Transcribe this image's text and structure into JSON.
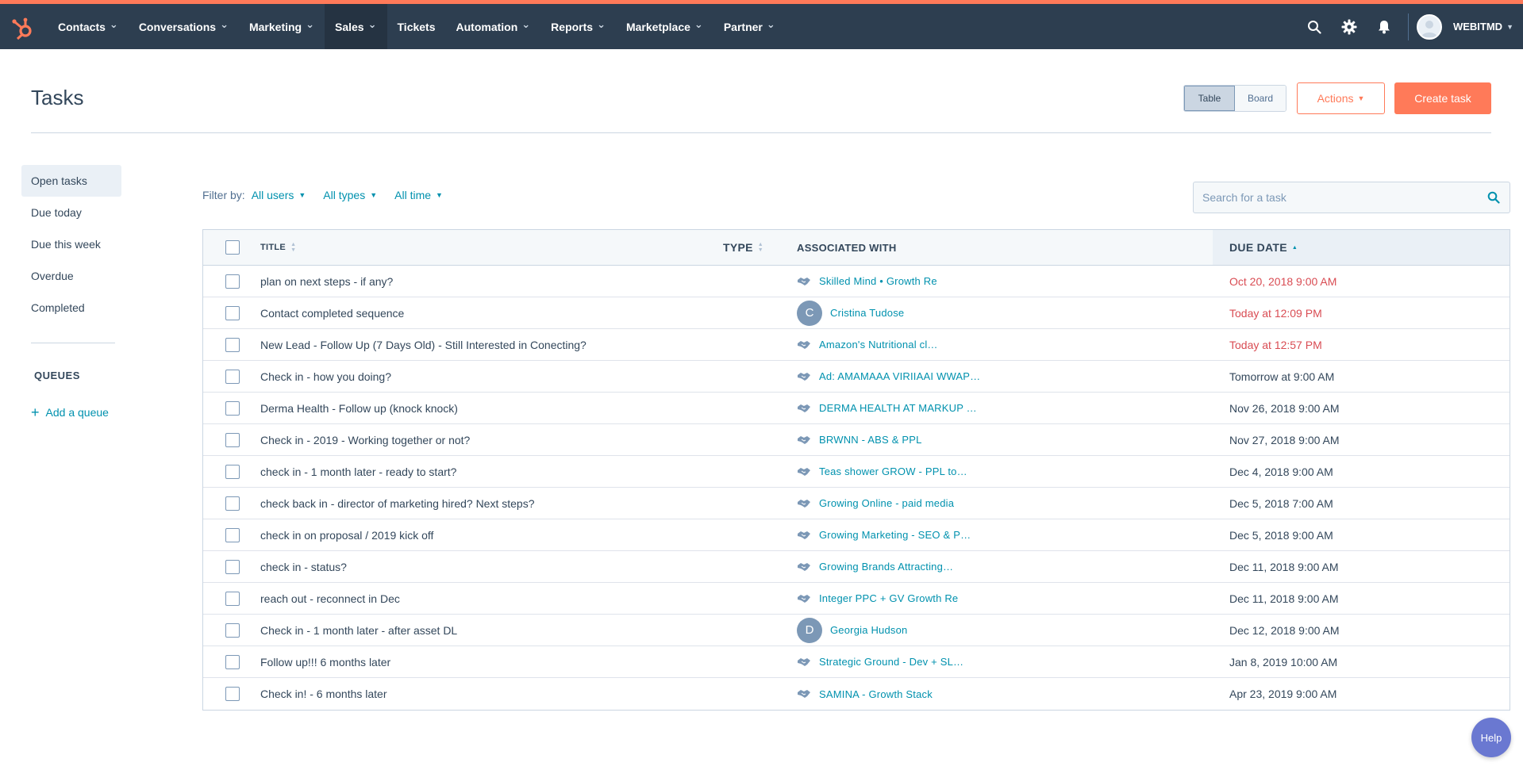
{
  "nav": {
    "items": [
      {
        "label": "Contacts",
        "has_menu": true,
        "name": "nav-contacts"
      },
      {
        "label": "Conversations",
        "has_menu": true,
        "name": "nav-conversations"
      },
      {
        "label": "Marketing",
        "has_menu": true,
        "name": "nav-marketing"
      },
      {
        "label": "Sales",
        "has_menu": true,
        "name": "nav-sales",
        "active": true
      },
      {
        "label": "Tickets",
        "has_menu": false,
        "name": "nav-tickets"
      },
      {
        "label": "Automation",
        "has_menu": true,
        "name": "nav-automation"
      },
      {
        "label": "Reports",
        "has_menu": true,
        "name": "nav-reports"
      },
      {
        "label": "Marketplace",
        "has_menu": true,
        "name": "nav-marketplace"
      },
      {
        "label": "Partner",
        "has_menu": true,
        "name": "nav-partner"
      }
    ],
    "account_name": "WEBITMD",
    "icons": [
      "search-icon",
      "gear-icon",
      "bell-icon"
    ]
  },
  "header": {
    "title": "Tasks",
    "view_table": "Table",
    "view_board": "Board",
    "actions_label": "Actions",
    "create_label": "Create task"
  },
  "sidebar": {
    "items": [
      {
        "label": "Open tasks",
        "active": true
      },
      {
        "label": "Due today"
      },
      {
        "label": "Due this week"
      },
      {
        "label": "Overdue"
      },
      {
        "label": "Completed"
      }
    ],
    "queues_label": "QUEUES",
    "add_queue_label": "Add a queue"
  },
  "filters": {
    "label": "Filter by:",
    "users": "All users",
    "types": "All types",
    "time": "All time",
    "search_placeholder": "Search for a task"
  },
  "table": {
    "columns": {
      "title": "TITLE",
      "type": "TYPE",
      "associated": "ASSOCIATED WITH",
      "due": "DUE DATE"
    },
    "rows": [
      {
        "title": "plan on next steps - if any?",
        "assoc_kind": "deal",
        "assoc": "Skilled Mind • Growth Re",
        "due": "Oct 20, 2018 9:00 AM",
        "overdue": true
      },
      {
        "title": "Contact completed sequence",
        "assoc_kind": "contact",
        "initial": "C",
        "assoc": "Cristina Tudose",
        "due": "Today at 12:09 PM",
        "overdue": true
      },
      {
        "title": "New Lead - Follow Up (7 Days Old) - Still Interested in Conecting?",
        "assoc_kind": "deal",
        "assoc": "Amazon's Nutritional cl…",
        "due": "Today at 12:57 PM",
        "overdue": true
      },
      {
        "title": "Check in - how you doing?",
        "assoc_kind": "deal",
        "assoc": "Ad: AMAMAAA VIRIIAAI WWAP…",
        "due": "Tomorrow at 9:00 AM",
        "overdue": false
      },
      {
        "title": "Derma Health - Follow up (knock knock)",
        "assoc_kind": "deal",
        "assoc": "DERMA HEALTH AT MARKUP …",
        "due": "Nov 26, 2018 9:00 AM",
        "overdue": false
      },
      {
        "title": "Check in - 2019 - Working together or not?",
        "assoc_kind": "deal",
        "assoc": "BRWNN - ABS & PPL",
        "due": "Nov 27, 2018 9:00 AM",
        "overdue": false
      },
      {
        "title": "check in - 1 month later - ready to start?",
        "assoc_kind": "deal",
        "assoc": "Teas shower GROW - PPL to…",
        "due": "Dec 4, 2018 9:00 AM",
        "overdue": false
      },
      {
        "title": "check back in - director of marketing hired? Next steps?",
        "assoc_kind": "deal",
        "assoc": "Growing Online - paid media",
        "due": "Dec 5, 2018 7:00 AM",
        "overdue": false
      },
      {
        "title": "check in on proposal / 2019 kick off",
        "assoc_kind": "deal",
        "assoc": "Growing Marketing - SEO & P…",
        "due": "Dec 5, 2018 9:00 AM",
        "overdue": false
      },
      {
        "title": "check in - status?",
        "assoc_kind": "deal",
        "assoc": "Growing Brands Attracting…",
        "due": "Dec 11, 2018 9:00 AM",
        "overdue": false
      },
      {
        "title": "reach out - reconnect in Dec",
        "assoc_kind": "deal",
        "assoc": "Integer PPC + GV Growth Re",
        "due": "Dec 11, 2018 9:00 AM",
        "overdue": false
      },
      {
        "title": "Check in - 1 month later - after asset DL",
        "assoc_kind": "contact",
        "initial": "D",
        "assoc": "Georgia Hudson",
        "due": "Dec 12, 2018 9:00 AM",
        "overdue": false
      },
      {
        "title": "Follow up!!! 6 months later",
        "assoc_kind": "deal",
        "assoc": "Strategic Ground - Dev + SL…",
        "due": "Jan 8, 2019 10:00 AM",
        "overdue": false
      },
      {
        "title": "Check in! - 6 months later",
        "assoc_kind": "deal",
        "assoc": "SAMINA - Growth Stack",
        "due": "Apr 23, 2019 9:00 AM",
        "overdue": false
      }
    ]
  },
  "help_label": "Help",
  "colors": {
    "nav_bg": "#2d3e50",
    "accent": "#ff7a59",
    "link": "#0091ae",
    "overdue": "#d94c53",
    "help": "#6a78d1"
  }
}
